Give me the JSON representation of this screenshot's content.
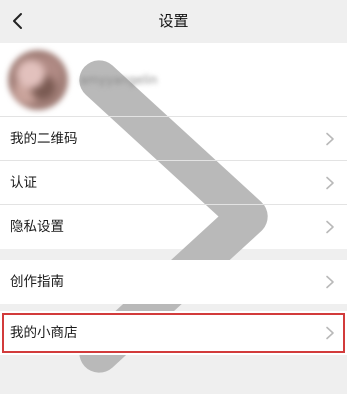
{
  "header": {
    "title": "设置"
  },
  "profile": {
    "username": "amyyangelin"
  },
  "menu_group_1": [
    {
      "label": "我的二维码"
    },
    {
      "label": "认证"
    },
    {
      "label": "隐私设置"
    }
  ],
  "menu_group_2": [
    {
      "label": "创作指南"
    }
  ],
  "menu_group_3": [
    {
      "label": "我的小商店"
    }
  ],
  "icons": {
    "back": "chevron-left-icon",
    "row_arrow": "chevron-right-icon"
  },
  "colors": {
    "background": "#efefef",
    "card": "#ffffff",
    "highlight_border": "#d23b3b",
    "chevron": "#b9b9b9"
  }
}
